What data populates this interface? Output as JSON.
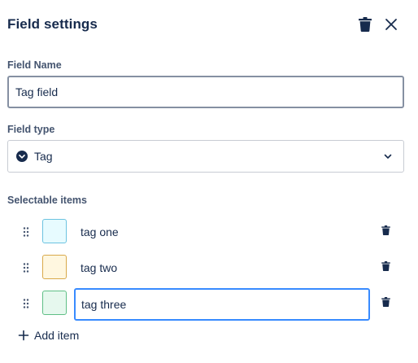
{
  "header": {
    "title": "Field settings",
    "delete_icon": "trash-icon",
    "close_icon": "close-icon"
  },
  "field_name": {
    "label": "Field Name",
    "value": "Tag field"
  },
  "field_type": {
    "label": "Field type",
    "icon": "chevron-circle-icon",
    "value": "Tag",
    "dropdown_icon": "chevron-down-icon"
  },
  "selectable_items": {
    "label": "Selectable items",
    "items": [
      {
        "label": "tag one",
        "swatch_color": "#e7fbff",
        "swatch_border": "#6cc3e0"
      },
      {
        "label": "tag two",
        "swatch_color": "#fff7e0",
        "swatch_border": "#d9a94a"
      },
      {
        "label": "tag three",
        "swatch_color": "#e6f8ee",
        "swatch_border": "#5fbf86",
        "editing": true
      }
    ]
  },
  "add_item": {
    "label": "Add item",
    "icon": "plus-icon"
  },
  "colors": {
    "text": "#172b4d",
    "focus_border": "#388bff"
  }
}
